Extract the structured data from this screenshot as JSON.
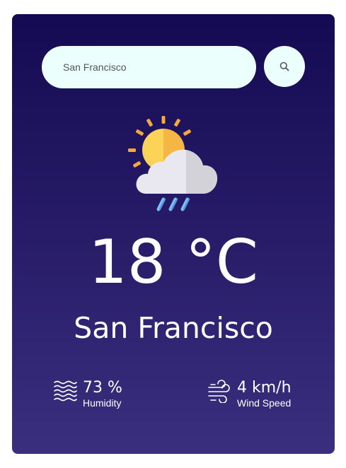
{
  "search": {
    "value": "San Francisco",
    "button_icon": "search-icon"
  },
  "weather": {
    "icon": "partly-cloudy-rain-icon",
    "temperature": "18 °C",
    "city": "San Francisco"
  },
  "details": {
    "humidity": {
      "icon": "humidity-waves-icon",
      "value": "73 %",
      "label": "Humidity"
    },
    "wind": {
      "icon": "wind-icon",
      "value": "4 km/h",
      "label": "Wind Speed"
    }
  },
  "colors": {
    "card_top": "#140a52",
    "card_bottom": "#3a2f7e",
    "input_background": "#ebfffc",
    "text": "#ffffff"
  }
}
